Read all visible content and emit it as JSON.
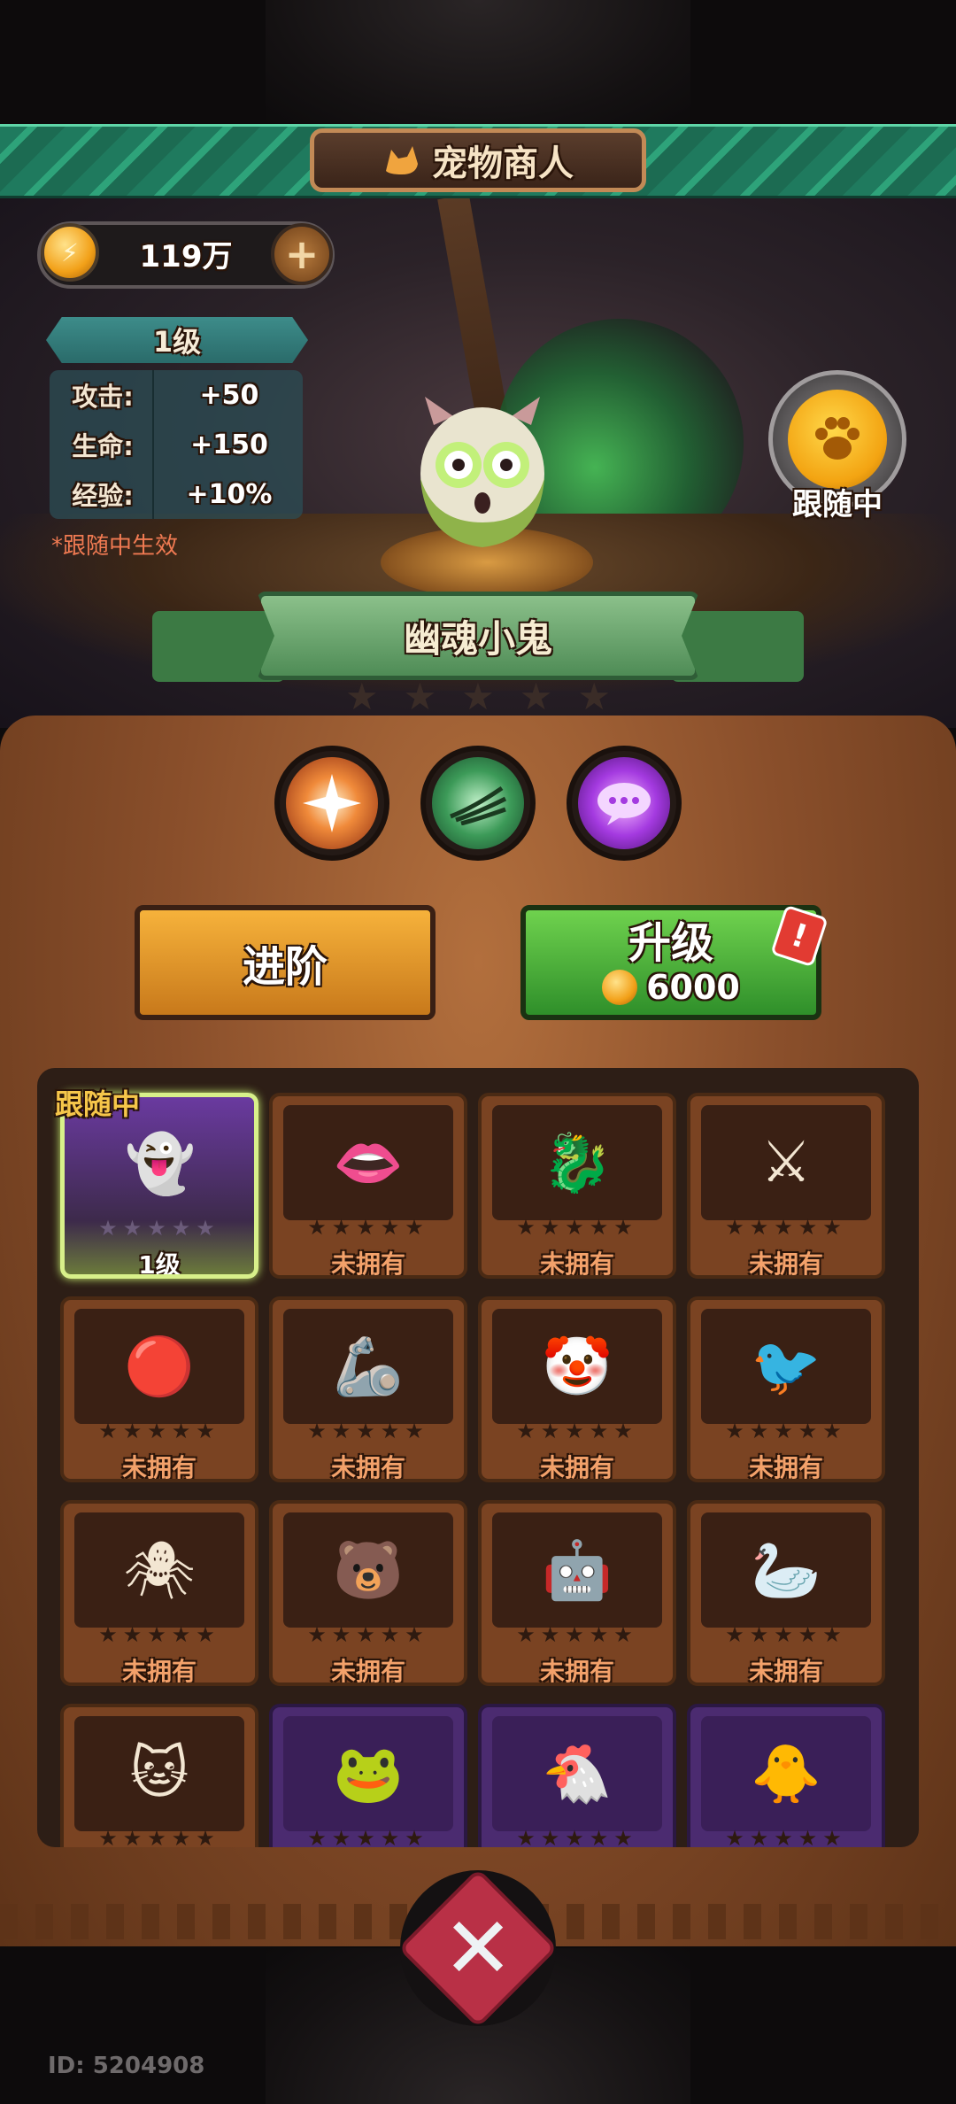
{
  "header": {
    "title": "宠物商人"
  },
  "currency": {
    "amount": "119万"
  },
  "pet_stats": {
    "level": "1级",
    "rows": [
      {
        "label": "攻击:",
        "value": "+50"
      },
      {
        "label": "生命:",
        "value": "+150"
      },
      {
        "label": "经验:",
        "value": "+10%"
      }
    ],
    "note": "*跟随中生效"
  },
  "follow": {
    "label": "跟随中"
  },
  "pet": {
    "name": "幽魂小鬼",
    "stars_filled": 0,
    "stars_total": 5
  },
  "skills": [
    {
      "icon": "burst-skill-icon"
    },
    {
      "icon": "claw-skill-icon"
    },
    {
      "icon": "speech-skill-icon"
    }
  ],
  "actions": {
    "advance_label": "进阶",
    "upgrade_label": "升级",
    "upgrade_cost": "6000",
    "alert": "!"
  },
  "grid": {
    "following_tag": "跟随中",
    "stars": "★★★★★",
    "cards": [
      {
        "icon": "ghost-imp-icon",
        "status": "1级",
        "style": "active"
      },
      {
        "icon": "chomper-icon",
        "status": "未拥有",
        "style": "brown"
      },
      {
        "icon": "dragon-icon",
        "status": "未拥有",
        "style": "brown"
      },
      {
        "icon": "knight-icon",
        "status": "未拥有",
        "style": "brown"
      },
      {
        "icon": "daruma-icon",
        "status": "未拥有",
        "style": "brown"
      },
      {
        "icon": "gauntlet-icon",
        "status": "未拥有",
        "style": "brown"
      },
      {
        "icon": "clown-icon",
        "status": "未拥有",
        "style": "brown"
      },
      {
        "icon": "crow-icon",
        "status": "未拥有",
        "style": "brown"
      },
      {
        "icon": "spider-icon",
        "status": "未拥有",
        "style": "brown"
      },
      {
        "icon": "bear-icon",
        "status": "未拥有",
        "style": "brown"
      },
      {
        "icon": "angel-bot-icon",
        "status": "未拥有",
        "style": "brown"
      },
      {
        "icon": "goose-icon",
        "status": "未拥有",
        "style": "brown"
      },
      {
        "icon": "cat-icon",
        "status": "",
        "style": "brown"
      },
      {
        "icon": "frog-icon",
        "status": "",
        "style": "purple"
      },
      {
        "icon": "chicken-icon",
        "status": "",
        "style": "purple"
      },
      {
        "icon": "zombie-bird-icon",
        "status": "",
        "style": "purple"
      }
    ]
  },
  "footer": {
    "id": "ID: 5204908"
  }
}
